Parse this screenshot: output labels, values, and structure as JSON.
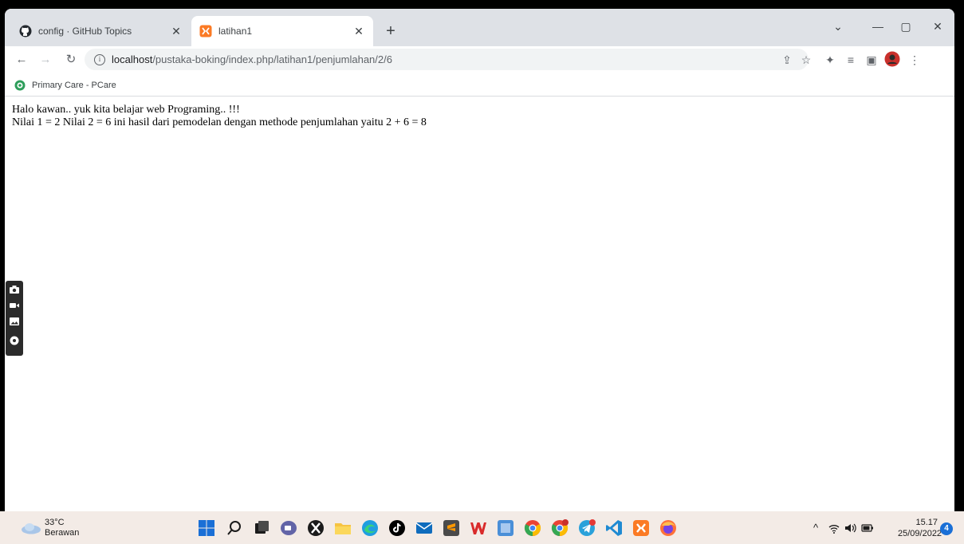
{
  "tabs": [
    {
      "title": "config · GitHub Topics",
      "icon": "github-icon"
    },
    {
      "title": "latihan1",
      "icon": "xampp-icon"
    }
  ],
  "address_bar": {
    "host": "localhost",
    "path": "/pustaka-boking/index.php/latihan1/penjumlahan/2/6"
  },
  "bookmarks": [
    {
      "label": "Primary Care - PCare",
      "icon": "pcare-icon"
    }
  ],
  "page": {
    "line1": "Halo kawan.. yuk kita belajar web Programing.. !!!",
    "line2": "Nilai 1 = 2 Nilai 2 = 6 ini hasil dari pemodelan dengan methode penjumlahan yaitu 2 + 6 = 8"
  },
  "weather": {
    "temperature": "33°C",
    "condition": "Berawan"
  },
  "clock": {
    "time": "15.17",
    "date": "25/09/2022"
  },
  "notifications": {
    "count": "4"
  },
  "colors": {
    "tabstrip": "#dee1e6",
    "taskbar": "#f3ebe6",
    "accent": "#1a6fd6"
  }
}
